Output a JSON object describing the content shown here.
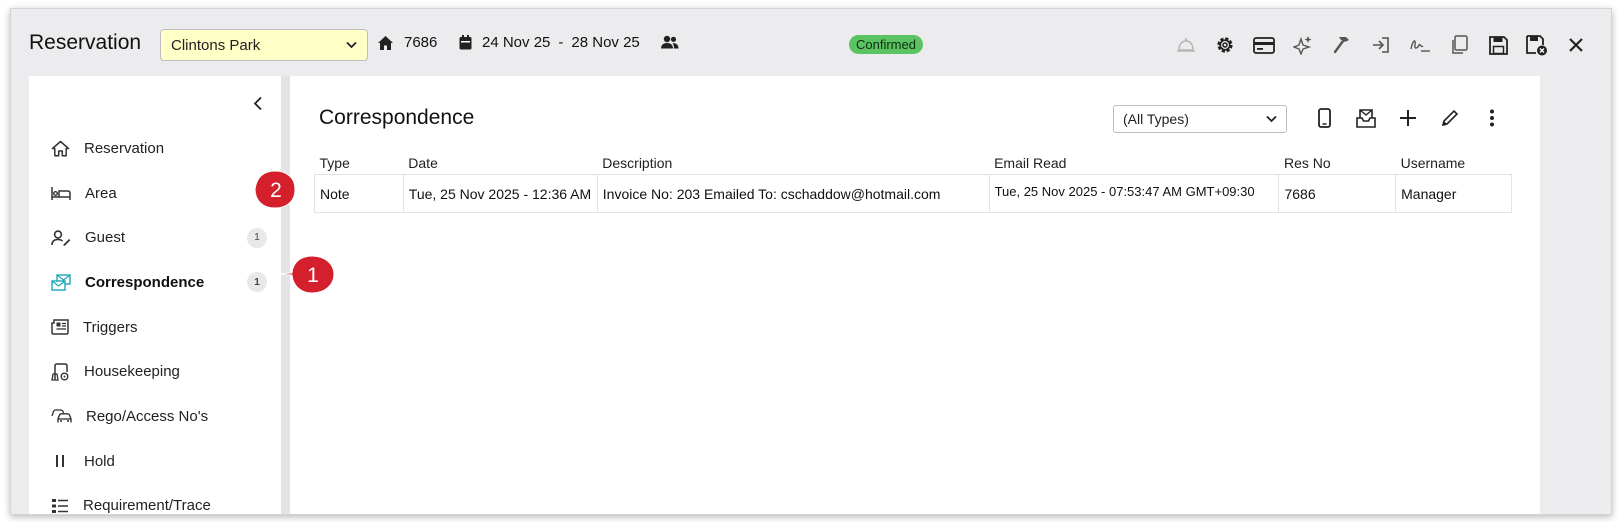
{
  "header": {
    "title": "Reservation",
    "property": "Clintons Park",
    "res_no": "7686",
    "date_from": "24 Nov 25",
    "date_sep": "-",
    "date_to": "28 Nov 25",
    "status": "Confirmed",
    "status_color": "#5bc361"
  },
  "toolbar": {
    "icons": [
      "bell-icon",
      "gear-icon",
      "credit-card-icon",
      "sparkle-icon",
      "hammer-icon",
      "check-in-icon",
      "signature-icon",
      "copy-icon",
      "save-icon",
      "save-close-icon",
      "close-icon"
    ]
  },
  "sidebar": {
    "items": [
      {
        "label": "Reservation",
        "badge": ""
      },
      {
        "label": "Area",
        "badge": ""
      },
      {
        "label": "Guest",
        "badge": "1"
      },
      {
        "label": "Correspondence",
        "badge": "1"
      },
      {
        "label": "Triggers",
        "badge": ""
      },
      {
        "label": "Housekeeping",
        "badge": ""
      },
      {
        "label": "Rego/Access No's",
        "badge": ""
      },
      {
        "label": "Hold",
        "badge": ""
      },
      {
        "label": "Requirement/Trace",
        "badge": ""
      }
    ],
    "accent_color": "#1aa7b8"
  },
  "main": {
    "title": "Correspondence",
    "type_filter": "(All Types)",
    "columns": [
      "Type",
      "Date",
      "Description",
      "Email Read",
      "Res No",
      "Username"
    ],
    "rows": [
      {
        "type": "Note",
        "date": "Tue, 25 Nov 2025 - 12:36 AM",
        "description": "Invoice No: 203 Emailed To: cschaddow@hotmail.com",
        "email_read": "Tue, 25 Nov 2025 - 07:53:47 AM GMT+09:30",
        "res_no": "7686",
        "username": "Manager"
      }
    ]
  },
  "callouts": [
    {
      "number": "1"
    },
    {
      "number": "2"
    }
  ],
  "callout_color": "#d4202d"
}
